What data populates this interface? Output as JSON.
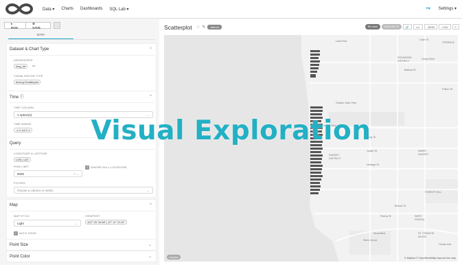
{
  "nav": {
    "items": [
      "Data",
      "Charts",
      "Dashboards",
      "SQL Lab"
    ],
    "data_caret": "Data ▾",
    "sql_caret": "SQL Lab ▾",
    "plus": "+▾",
    "settings": "Settings ▾"
  },
  "toolbar": {
    "run": "▸ RUN",
    "save": "⚙ SAVE"
  },
  "tabs": {
    "data": "DATA"
  },
  "sections": {
    "dataset": {
      "title": "Dataset & Chart Type",
      "datasource_label": "DATASOURCE",
      "datasource_value": "long_lat",
      "datasource_more": "•••",
      "viz_label": "VISUALIZATION TYPE",
      "viz_value": "deck.gl Scatterplot"
    },
    "time": {
      "title": "Time ⓘ",
      "column_label": "TIME COLUMN",
      "column_value": "1 option(s)",
      "range_label": "TIME RANGE",
      "range_value": "-∞ ≤ col ≤ ∞"
    },
    "query": {
      "title": "Query",
      "lonlat_label": "LONGITUDE & LATITUDE",
      "lonlat_value": "LON | LAT",
      "rowlimit_label": "ROW LIMIT",
      "rowlimit_value": "5000",
      "ignore_label": "IGNORE NULL LOCATIONS",
      "filters_label": "FILTERS",
      "filters_placeholder": "choose a column or metric"
    },
    "map": {
      "title": "Map",
      "style_label": "MAP STYLE",
      "style_value": "Light",
      "viewport_label": "VIEWPORT",
      "viewport_value": "122° 25' 34.68\" | 37° 47' 21.57\"",
      "autozoom_label": "AUTO ZOOM"
    },
    "point_size": {
      "title": "Point Size"
    },
    "point_color": {
      "title": "Point Color"
    }
  },
  "chart": {
    "title": "Scatterplot",
    "badge": "Altered",
    "rows_badge": "0k rows",
    "time_badge": "00:00:00.75",
    "buttons": [
      "🔗",
      "</>",
      ".JSON",
      ".CSV",
      "≡"
    ]
  },
  "map_labels": {
    "attribution": "© Mapbox © OpenStreetMap Improve this map",
    "mapbox": "mapbox",
    "places": [
      "Land End",
      "Lake St",
      "Golden Gate Park",
      "Lincoln Way",
      "SUNSET DISTRICT",
      "Irving St",
      "Judah St",
      "Noriega St",
      "Taraval St",
      "Sloat Blvd",
      "Stern Grove",
      "ST. FRANCIS WOOD",
      "WEST PORTAL",
      "FOREST HILL",
      "INNER SUNSET",
      "Fulton St",
      "Geary Blvd",
      "RICHMOND DISTRICT",
      "TERRACE",
      "Balboa St",
      "Ocean Ave"
    ]
  },
  "overlay": "Visual Exploration",
  "colors": {
    "accent": "#20a7c9",
    "overlay": "#23b0c4"
  }
}
